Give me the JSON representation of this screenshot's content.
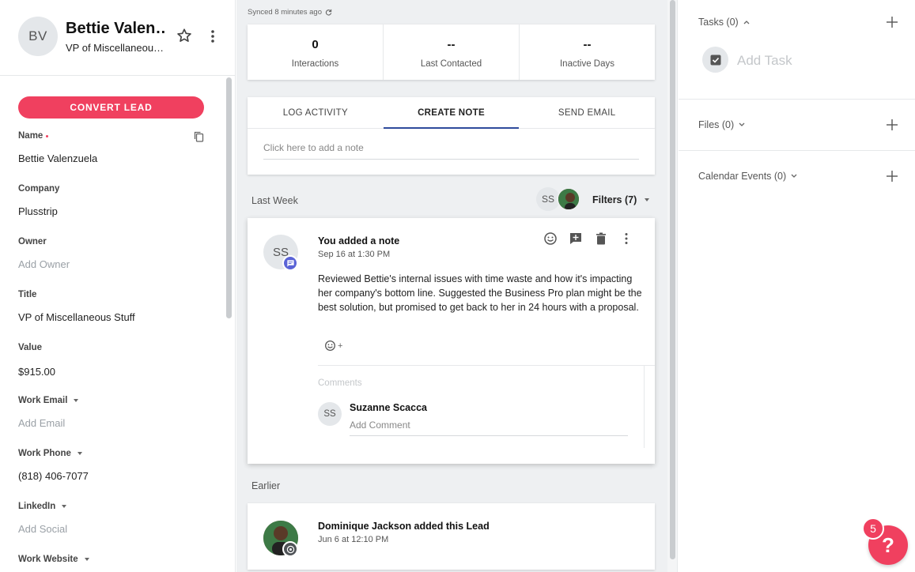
{
  "lead": {
    "initials": "BV",
    "name": "Bettie Valen…",
    "subtitle": "VP of Miscellaneou…"
  },
  "convert_label": "CONVERT LEAD",
  "fields": [
    {
      "label": "Name",
      "value": "Bettie Valenzuela",
      "required": true,
      "placeholder": false
    },
    {
      "label": "Company",
      "value": "Plusstrip",
      "placeholder": false
    },
    {
      "label": "Owner",
      "value": "Add Owner",
      "placeholder": true
    },
    {
      "label": "Title",
      "value": "VP of Miscellaneous Stuff",
      "placeholder": false
    },
    {
      "label": "Value",
      "value": "$915.00",
      "placeholder": false
    },
    {
      "label": "Work Email",
      "value": "Add Email",
      "placeholder": true,
      "dropdown": true
    },
    {
      "label": "Work Phone",
      "value": "(818) 406-7077",
      "placeholder": false,
      "dropdown": true
    },
    {
      "label": "LinkedIn",
      "value": "Add Social",
      "placeholder": true,
      "dropdown": true
    },
    {
      "label": "Work Website",
      "value": "",
      "placeholder": true,
      "dropdown": true
    }
  ],
  "synced_text": "Synced 8 minutes ago",
  "stats": [
    {
      "value": "0",
      "label": "Interactions"
    },
    {
      "value": "--",
      "label": "Last Contacted"
    },
    {
      "value": "--",
      "label": "Inactive Days"
    }
  ],
  "tabs": [
    {
      "label": "LOG ACTIVITY",
      "active": false
    },
    {
      "label": "CREATE NOTE",
      "active": true
    },
    {
      "label": "SEND EMAIL",
      "active": false
    }
  ],
  "note_placeholder": "Click here to add a note",
  "last_week_label": "Last Week",
  "filter_avatar_initials": "SS",
  "filters_label": "Filters (7)",
  "note": {
    "initials": "SS",
    "title": "You added a note",
    "date": "Sep 16 at 1:30 PM",
    "body": "Reviewed Bettie's internal issues with time waste and how it's impacting her company's bottom line. Suggested the Business Pro plan might be the best solution, but promised to get back to her in 24 hours with a proposal.",
    "react_plus": "+",
    "comments_label": "Comments",
    "commenter_initials": "SS",
    "commenter_name": "Suzanne Scacca",
    "comment_placeholder": "Add Comment"
  },
  "earlier_label": "Earlier",
  "lead_event": {
    "title": "Dominique Jackson added this Lead",
    "date": "Jun 6 at 12:10 PM"
  },
  "right": {
    "tasks_label": "Tasks (0)",
    "add_task_label": "Add Task",
    "files_label": "Files (0)",
    "calendar_label": "Calendar Events (0)"
  },
  "help": {
    "icon": "?",
    "badge": "5"
  },
  "colors": {
    "accent": "#f0405f",
    "tab_underline": "#2f4b9c",
    "note_badge": "#5a63d6"
  }
}
